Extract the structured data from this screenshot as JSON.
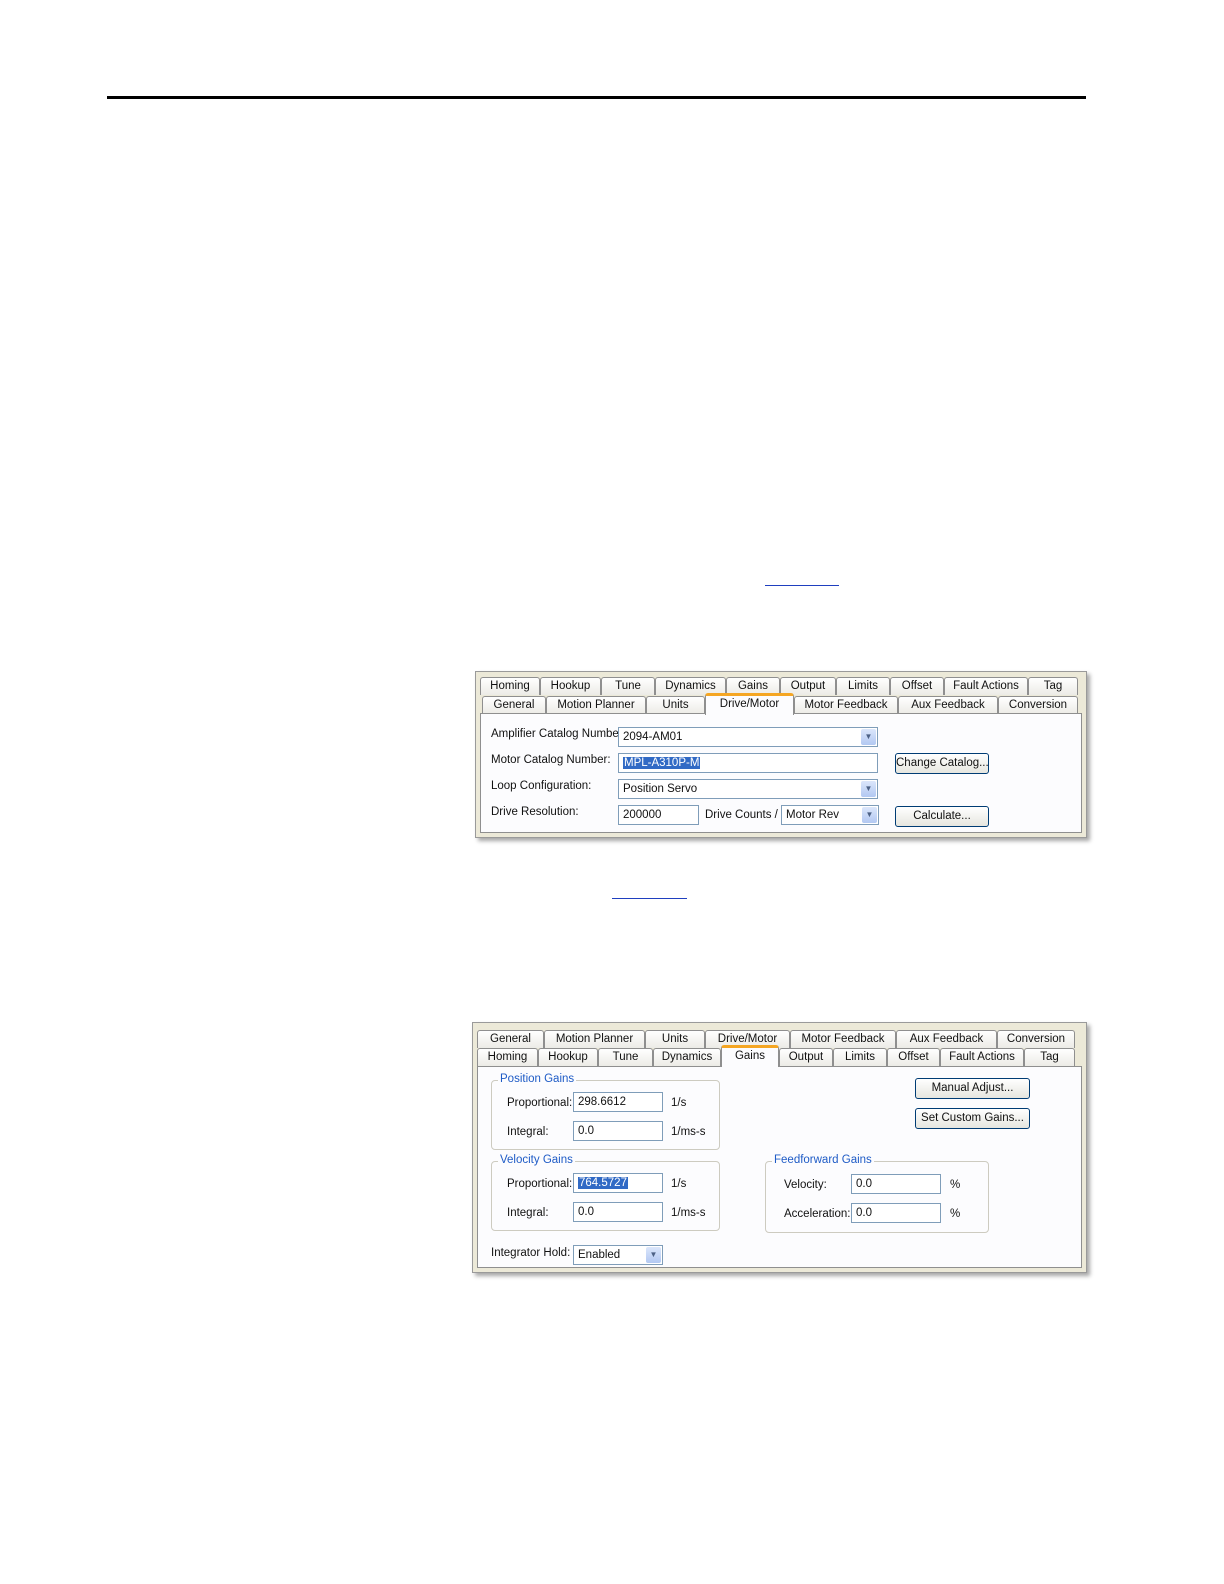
{
  "dialog1": {
    "tabs_back": [
      "Homing",
      "Hookup",
      "Tune",
      "Dynamics",
      "Gains",
      "Output",
      "Limits",
      "Offset",
      "Fault Actions",
      "Tag"
    ],
    "tabs_front": [
      "General",
      "Motion Planner",
      "Units",
      "Drive/Motor",
      "Motor Feedback",
      "Aux Feedback",
      "Conversion"
    ],
    "active_tab": "Drive/Motor",
    "amplifier_label": "Amplifier Catalog Number:",
    "amplifier_value": "2094-AM01",
    "motor_label": "Motor Catalog Number:",
    "motor_value": "MPL-A310P-M",
    "change_catalog": "Change Catalog...",
    "loop_label": "Loop Configuration:",
    "loop_value": "Position Servo",
    "resolution_label": "Drive Resolution:",
    "resolution_value": "200000",
    "drive_counts_label": "Drive Counts /",
    "motor_rev_value": "Motor Rev",
    "calculate": "Calculate..."
  },
  "dialog2": {
    "tabs_back": [
      "General",
      "Motion Planner",
      "Units",
      "Drive/Motor",
      "Motor Feedback",
      "Aux Feedback",
      "Conversion"
    ],
    "tabs_front": [
      "Homing",
      "Hookup",
      "Tune",
      "Dynamics",
      "Gains",
      "Output",
      "Limits",
      "Offset",
      "Fault Actions",
      "Tag"
    ],
    "active_tab": "Gains",
    "position_gains": {
      "title": "Position Gains",
      "proportional_label": "Proportional:",
      "proportional_value": "298.6612",
      "proportional_unit": "1/s",
      "integral_label": "Integral:",
      "integral_value": "0.0",
      "integral_unit": "1/ms-s"
    },
    "velocity_gains": {
      "title": "Velocity Gains",
      "proportional_label": "Proportional:",
      "proportional_value": "764.5727",
      "proportional_unit": "1/s",
      "integral_label": "Integral:",
      "integral_value": "0.0",
      "integral_unit": "1/ms-s"
    },
    "feedforward_gains": {
      "title": "Feedforward Gains",
      "velocity_label": "Velocity:",
      "velocity_value": "0.0",
      "velocity_unit": "%",
      "acceleration_label": "Acceleration:",
      "acceleration_value": "0.0",
      "acceleration_unit": "%"
    },
    "manual_adjust": "Manual Adjust...",
    "set_custom_gains": "Set Custom Gains...",
    "integrator_hold_label": "Integrator Hold:",
    "integrator_hold_value": "Enabled"
  }
}
